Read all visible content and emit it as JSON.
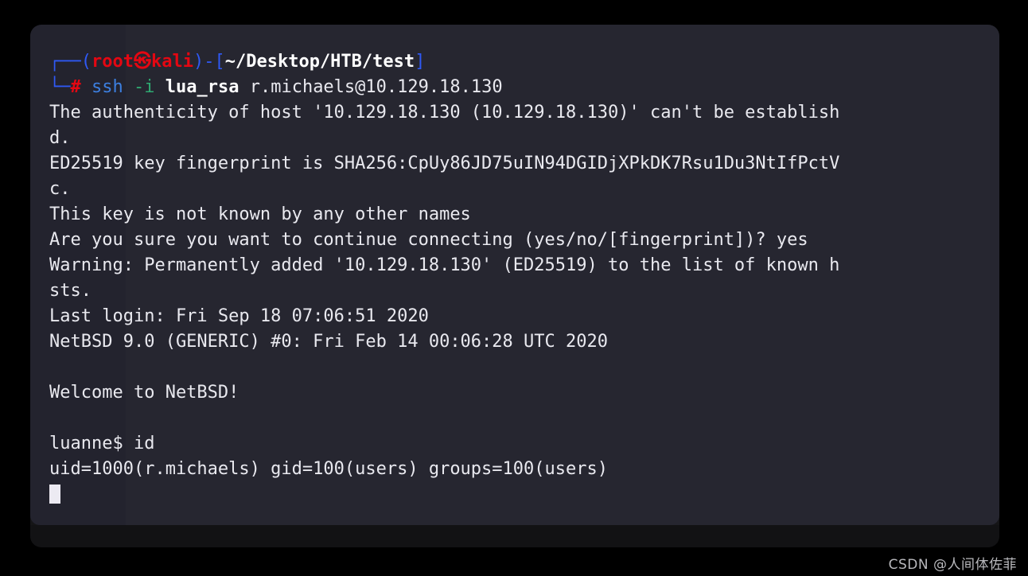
{
  "window": {
    "kind": "terminal-emulator",
    "background_color": "#23232e",
    "footer_color": "#121214",
    "page_background": "#000000"
  },
  "colors": {
    "prompt_bracket": "#2f59f5",
    "prompt_user": "#e40712",
    "prompt_path": "#ffffff",
    "command_name": "#3c7fe0",
    "command_flag": "#2fab72",
    "output_text": "#e9e9ef",
    "cursor": "#eceaf2"
  },
  "prompt": {
    "deco_top": "┌──",
    "deco_bottom": "└─",
    "open_paren": "(",
    "user": "root",
    "at_symbol": "㉿",
    "host": "kali",
    "close_paren": ")",
    "dash": "-",
    "bracket_open": "[",
    "path": "~/Desktop/HTB/test",
    "bracket_close": "]",
    "sigil": "#"
  },
  "command": {
    "name": "ssh",
    "flag": "-i",
    "keyfile": "lua_rsa",
    "target": "r.michaels@10.129.18.130"
  },
  "output": {
    "lines": [
      "The authenticity of host '10.129.18.130 (10.129.18.130)' can't be establish",
      "d.",
      "ED25519 key fingerprint is SHA256:CpUy86JD75uIN94DGIDjXPkDK7Rsu1Du3NtIfPctV",
      "c.",
      "This key is not known by any other names",
      "Are you sure you want to continue connecting (yes/no/[fingerprint])? yes",
      "Warning: Permanently added '10.129.18.130' (ED25519) to the list of known h",
      "sts.",
      "Last login: Fri Sep 18 07:06:51 2020",
      "NetBSD 9.0 (GENERIC) #0: Fri Feb 14 00:06:28 UTC 2020",
      "",
      "Welcome to NetBSD!",
      "",
      "luanne$ id",
      "uid=1000(r.michaels) gid=100(users) groups=100(users)"
    ]
  },
  "session": {
    "remote_prompt": "luanne$",
    "remote_command": "id",
    "id_result": "uid=1000(r.michaels) gid=100(users) groups=100(users)",
    "host_ip": "10.129.18.130",
    "remote_user": "r.michaels",
    "os_banner": "NetBSD 9.0 (GENERIC) #0: Fri Feb 14 00:06:28 UTC 2020",
    "welcome": "Welcome to NetBSD!",
    "last_login": "Last login: Fri Sep 18 07:06:51 2020"
  },
  "watermark": {
    "text": "CSDN @人间体佐菲"
  }
}
